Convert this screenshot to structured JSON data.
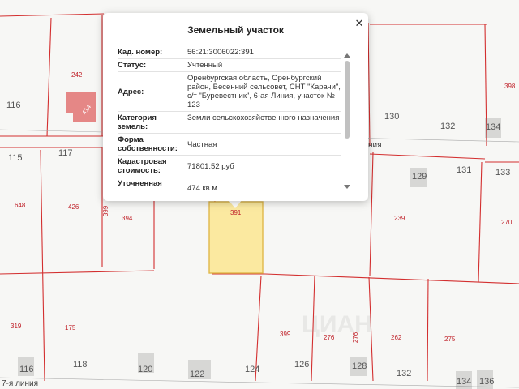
{
  "popup": {
    "title": "Земельный участок",
    "close_icon": "close-icon",
    "rows": [
      {
        "key": "Кад. номер:",
        "value": "56:21:3006022:391"
      },
      {
        "key": "Статус:",
        "value": "Учтенный"
      },
      {
        "key": "Адрес:",
        "value": "Оренбургская область, Оренбургский район, Весенний сельсовет, СНТ \"Карачи\", с/т \"Буревестник\", 6-ая Линия, участок № 123"
      },
      {
        "key": "Категория земель:",
        "value": "Земли сельскохозяйственного назначения"
      },
      {
        "key": "Форма собственности:",
        "value": "Частная"
      },
      {
        "key": "Кадастровая стоимость:",
        "value": "71801.52 руб"
      },
      {
        "key": "Уточненная площадь:",
        "value": "474 кв.м"
      }
    ]
  },
  "map": {
    "plot_numbers": {
      "n116a": "116",
      "n242": "242",
      "n130": "130",
      "n132a": "132",
      "n134a": "134",
      "n398": "398",
      "n115": "115",
      "n117": "117",
      "n648": "648",
      "n426": "426",
      "n394": "394",
      "n399a": "399",
      "n391": "391",
      "n239": "239",
      "n129": "129",
      "n131": "131",
      "n133": "133",
      "n270": "270",
      "n319": "319",
      "n175": "175",
      "n399b": "399",
      "n276a": "276",
      "n276b": "276",
      "n262": "262",
      "n275": "275",
      "n116b": "116",
      "n118": "118",
      "n120": "120",
      "n122": "122",
      "n124": "124",
      "n126": "126",
      "n128": "128",
      "n132b": "132",
      "n134b": "134",
      "n136": "136",
      "n414": "414"
    },
    "street_top": "ния",
    "street_bottom": "7-я линия",
    "watermark": "ЦИАН"
  },
  "colors": {
    "boundary": "#d32f2f",
    "selected_fill": "#fbe9a0",
    "selected_stroke": "#e0b84a",
    "building": "#e27a7a"
  }
}
